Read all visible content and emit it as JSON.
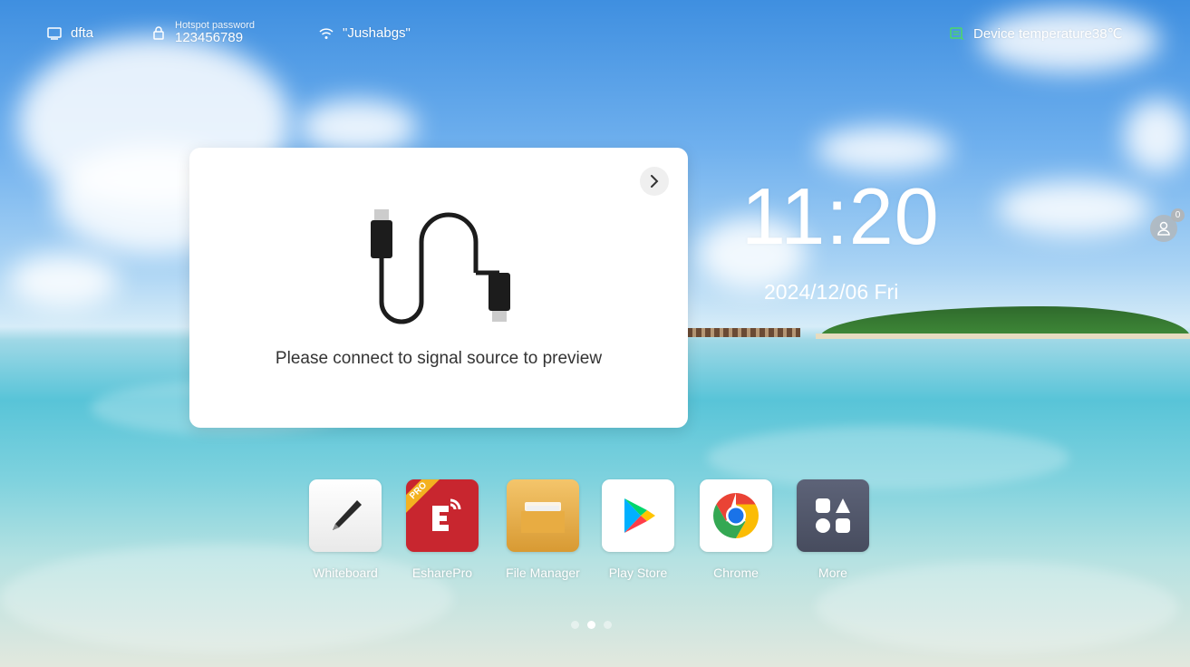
{
  "status_bar": {
    "network_name": "dfta",
    "hotspot_label": "Hotspot password",
    "hotspot_password": "123456789",
    "wifi_ssid": "\"Jushabgs\"",
    "device_temperature": "Device temperature38℃"
  },
  "preview_card": {
    "message": "Please connect to signal source to preview",
    "next_icon": "chevron-right-icon"
  },
  "clock": {
    "time": "11:20",
    "date": "2024/12/06 Fri"
  },
  "user": {
    "badge_count": "0"
  },
  "dock": {
    "apps": [
      {
        "label": "Whiteboard",
        "icon": "pen-icon"
      },
      {
        "label": "EsharePro",
        "icon": "eshare-icon",
        "badge": "PRO"
      },
      {
        "label": "File Manager",
        "icon": "folder-icon"
      },
      {
        "label": "Play Store",
        "icon": "play-store-icon"
      },
      {
        "label": "Chrome",
        "icon": "chrome-icon"
      },
      {
        "label": "More",
        "icon": "more-apps-icon"
      }
    ]
  },
  "pager": {
    "pages": 3,
    "active": 2
  }
}
